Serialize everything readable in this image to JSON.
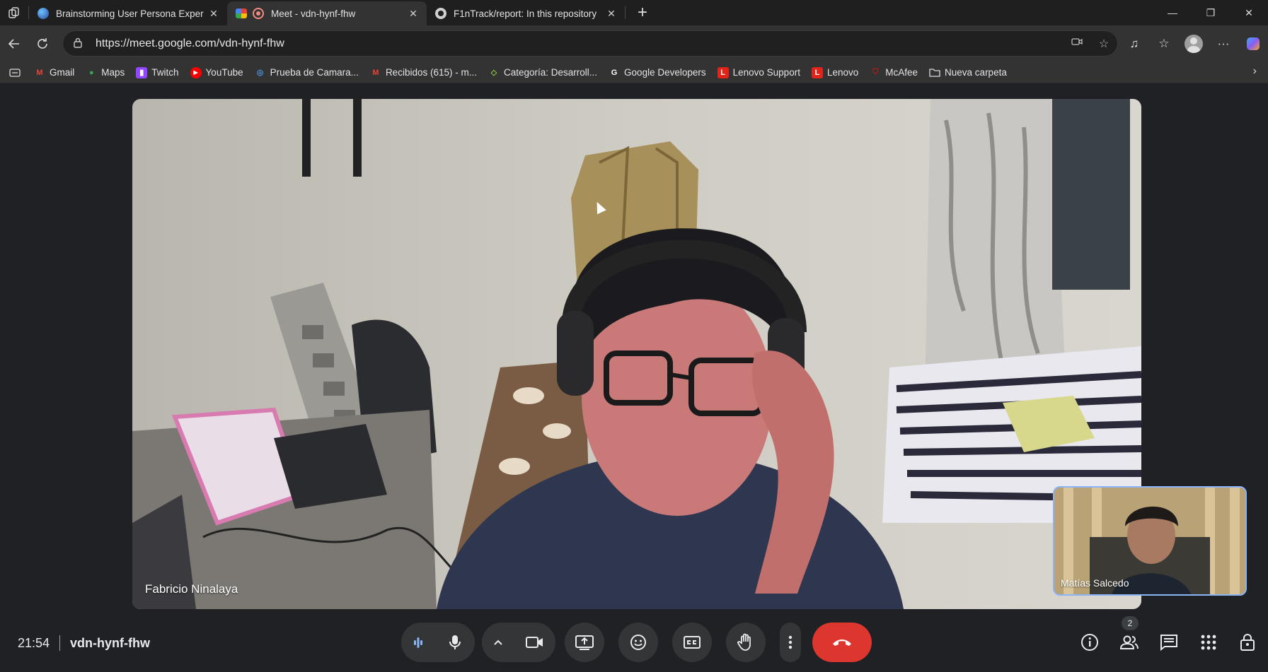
{
  "browser": {
    "tabs": [
      {
        "title": "Brainstorming User Persona Exper",
        "favicon": "copilot-icon",
        "active": false
      },
      {
        "title": "Meet - vdn-hynf-fhw",
        "favicon": "meet-icon",
        "active": true
      },
      {
        "title": "F1nTrack/report: In this repository",
        "favicon": "github-icon",
        "active": false
      }
    ],
    "new_tab": "+",
    "url": "https://meet.google.com/vdn-hynf-fhw",
    "bookmarks": [
      {
        "label": "Gmail",
        "icon": "gmail-icon",
        "color": "#ea4335"
      },
      {
        "label": "Maps",
        "icon": "maps-icon",
        "color": "#34a853"
      },
      {
        "label": "Twitch",
        "icon": "twitch-icon",
        "color": "#9146ff"
      },
      {
        "label": "YouTube",
        "icon": "youtube-icon",
        "color": "#ff0000"
      },
      {
        "label": "Prueba de Camara...",
        "icon": "camera-test-icon",
        "color": "#4a90d9"
      },
      {
        "label": "Recibidos (615) - m...",
        "icon": "gmail-icon",
        "color": "#ea4335"
      },
      {
        "label": "Categoría: Desarroll...",
        "icon": "diamond-icon",
        "color": "#8bc34a"
      },
      {
        "label": "Google Developers",
        "icon": "google-icon",
        "color": "#ffffff"
      },
      {
        "label": "Lenovo Support",
        "icon": "lenovo-icon",
        "color": "#e2231a"
      },
      {
        "label": "Lenovo",
        "icon": "lenovo-icon",
        "color": "#e2231a"
      },
      {
        "label": "McAfee",
        "icon": "mcafee-icon",
        "color": "#c01818"
      },
      {
        "label": "Nueva carpeta",
        "icon": "folder-icon",
        "color": "#dcdcdc"
      }
    ]
  },
  "meet": {
    "main_participant": "Fabricio Ninalaya",
    "self_participant": "Matías Salcedo",
    "time": "21:54",
    "meeting_code": "vdn-hynf-fhw",
    "people_count": "2",
    "colors": {
      "accent": "#8ab4f8",
      "leave": "#dc362e",
      "control_bg": "#333537",
      "background": "#202124"
    }
  }
}
